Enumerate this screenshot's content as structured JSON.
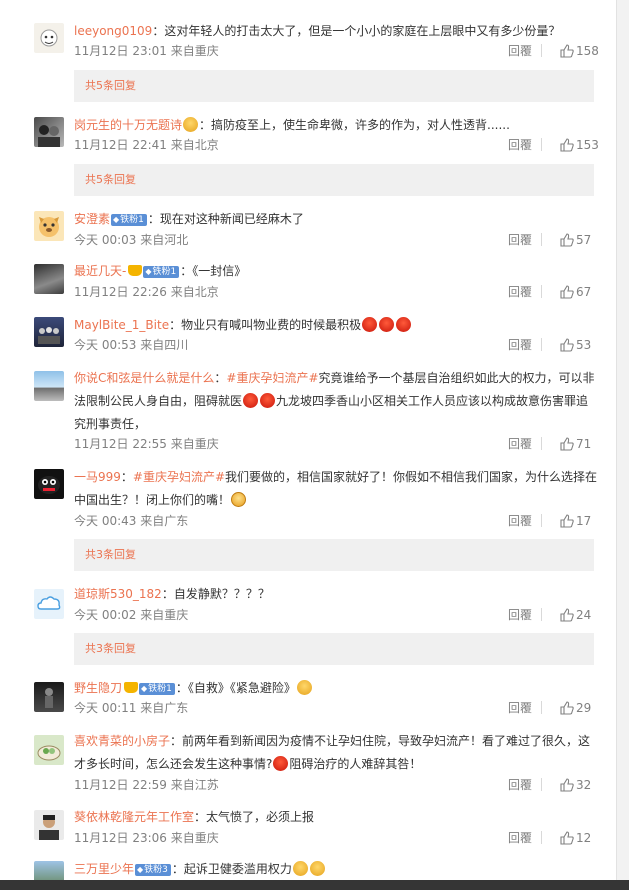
{
  "comments": [
    {
      "username": "leeyong0109",
      "text": "这对年轻人的打击太大了，但是一个小小的家庭在上层眼中又有多少份量？",
      "time": "11月12日 23:01",
      "source": "来自重庆",
      "reply_label": "回覆",
      "likes": "158",
      "more_replies": "共5条回复",
      "avatar": "cartoon-avatar"
    },
    {
      "username": "岗元生的十万无题诗",
      "text": "搞防疫至上，使生命卑微，许多的作为，对人性透背......",
      "time": "11月12日 22:41",
      "source": "来自北京",
      "reply_label": "回覆",
      "likes": "153",
      "more_replies": "共5条回复",
      "avatar": "portrait-avatar"
    },
    {
      "username": "安澄素",
      "badge": "铁粉1",
      "text": "现在对这种新闻已经麻木了",
      "time": "今天 00:03",
      "source": "来自河北",
      "reply_label": "回覆",
      "likes": "57",
      "avatar": "dog-avatar"
    },
    {
      "username": "最近几天-",
      "badge": "铁粉1",
      "text": "《一封信》",
      "time": "11月12日 22:26",
      "source": "来自北京",
      "reply_label": "回覆",
      "likes": "67",
      "avatar": "rock-avatar"
    },
    {
      "username": "MaylBite_1_Bite",
      "text": "物业只有喊叫物业费的时候最积极",
      "time": "今天 00:53",
      "source": "来自四川",
      "reply_label": "回覆",
      "likes": "53",
      "avatar": "group-avatar"
    },
    {
      "username": "你说C和弦是什么就是什么",
      "topic": "#重庆孕妇流产#",
      "text_line1": "究竟谁给予一个基层自治组织如此大的权力，可以非",
      "text_line2a": "法限制公民人身自由，阻碍就医",
      "text_line2b": "九龙坡四季香山小区相关工作人员应该以构成故意伤害罪追",
      "text_line3": "究刑事责任，",
      "time": "11月12日 22:55",
      "source": "来自重庆",
      "reply_label": "回覆",
      "likes": "71",
      "avatar": "sky-avatar"
    },
    {
      "username": "一马999",
      "topic": "#重庆孕妇流产#",
      "text_line1": "我们要做的，相信国家就好了！你假如不相信我们国家，为什么选择在",
      "text_line2": "中国出生？！闭上你们的嘴！",
      "time": "今天 00:43",
      "source": "来自广东",
      "reply_label": "回覆",
      "likes": "17",
      "more_replies": "共3条回复",
      "avatar": "creature-avatar"
    },
    {
      "username": "道琼斯530_182",
      "text": "自发静默？？？？",
      "time": "今天 00:02",
      "source": "来自重庆",
      "reply_label": "回覆",
      "likes": "24",
      "more_replies": "共3条回复",
      "avatar": "cloud-avatar"
    },
    {
      "username": "野生隐刀",
      "badge": "铁粉1",
      "text": "《自救》《紧急避险》",
      "time": "今天 00:11",
      "source": "来自广东",
      "reply_label": "回覆",
      "likes": "29",
      "avatar": "figure-avatar"
    },
    {
      "username": "喜欢青菜的小房子",
      "text_line1": "前两年看到新闻因为疫情不让孕妇住院，导致孕妇流产！看了难过了很久，这",
      "text_line2a": "才多长时间，怎么还会发生这种事情?",
      "text_line2b": "阻碍治疗的人难辞其咎！",
      "time": "11月12日 22:59",
      "source": "来自江苏",
      "reply_label": "回覆",
      "likes": "32",
      "avatar": "food-avatar"
    },
    {
      "username": "葵依林乾隆元年工作室",
      "text": "太气愤了，必须上报",
      "time": "11月12日 23:06",
      "source": "来自重庆",
      "reply_label": "回覆",
      "likes": "12",
      "avatar": "man-avatar"
    },
    {
      "username": "三万里少年",
      "badge": "铁粉3",
      "text": "起诉卫健委滥用权力",
      "avatar": "landscape-avatar"
    }
  ],
  "colors": {
    "link": "#eb7350",
    "meta": "#808080",
    "more_bg": "#f0f0f0"
  }
}
